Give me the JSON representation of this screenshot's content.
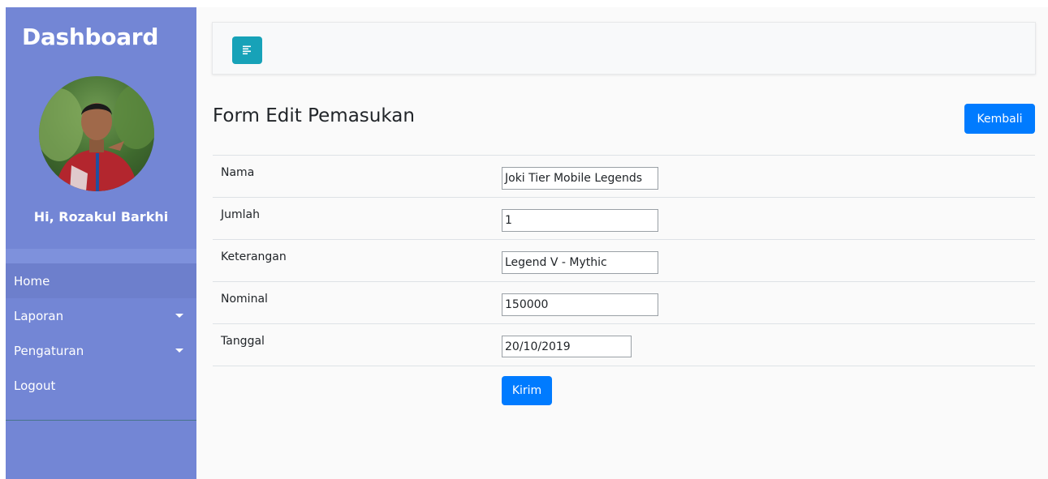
{
  "sidebar": {
    "brand": "Dashboard",
    "greeting": "Hi, Rozakul Barkhi",
    "items": [
      {
        "label": "Home"
      },
      {
        "label": "Laporan"
      },
      {
        "label": "Pengaturan"
      },
      {
        "label": "Logout"
      }
    ]
  },
  "topbar": {
    "toggle_icon": "align-left-icon"
  },
  "page": {
    "title": "Form Edit Pemasukan",
    "back_label": "Kembali"
  },
  "form": {
    "fields": [
      {
        "label": "Nama",
        "value": "Joki Tier Mobile Legends"
      },
      {
        "label": "Jumlah",
        "value": "1"
      },
      {
        "label": "Keterangan",
        "value": "Legend V - Mythic"
      },
      {
        "label": "Nominal",
        "value": "150000"
      },
      {
        "label": "Tanggal",
        "value": "20/10/2019"
      }
    ],
    "submit_label": "Kirim"
  },
  "colors": {
    "sidebar": "#7386d5",
    "primary": "#007bff",
    "info": "#17a2b8"
  }
}
